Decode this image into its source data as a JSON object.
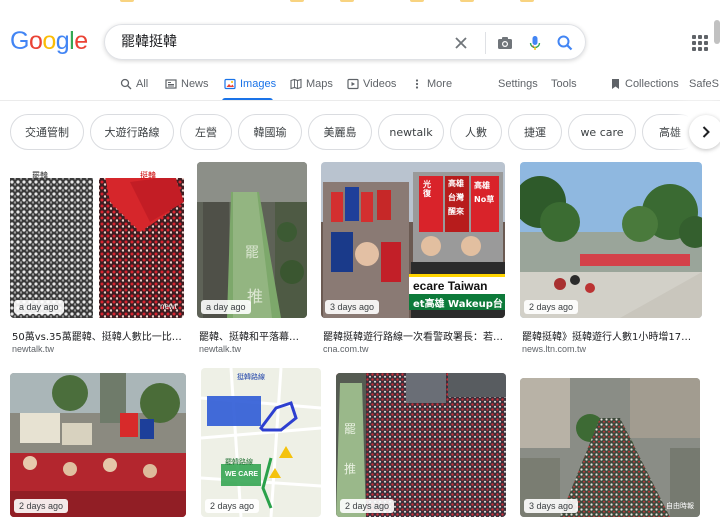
{
  "search": {
    "query": "罷韓挺韓"
  },
  "logo": {
    "letters": [
      "G",
      "o",
      "o",
      "g",
      "l",
      "e"
    ]
  },
  "tabs": [
    {
      "label": "All",
      "icon": "search-icon",
      "active": false
    },
    {
      "label": "News",
      "icon": "newspaper-icon",
      "active": false
    },
    {
      "label": "Images",
      "icon": "image-icon",
      "active": true
    },
    {
      "label": "Maps",
      "icon": "map-icon",
      "active": false
    },
    {
      "label": "Videos",
      "icon": "play-icon",
      "active": false
    },
    {
      "label": "More",
      "icon": "more-vert-icon",
      "active": false
    }
  ],
  "tools": {
    "settings": "Settings",
    "tools": "Tools",
    "collections": "Collections",
    "safesearch": "SafeS"
  },
  "chips": [
    "交通管制",
    "大遊行路線",
    "左營",
    "韓國瑜",
    "美麗島",
    "newtalk",
    "人數",
    "捷運",
    "we care",
    "高雄"
  ],
  "row1": [
    {
      "age": "a day ago",
      "title": "50萬vs.35萬罷韓、挺韓人數比一比| 政...",
      "source": "newtalk.tw",
      "labels": [
        "罷韓",
        "挺韓"
      ],
      "watermark": "newt"
    },
    {
      "age": "a day ago",
      "title": "罷韓、挺韓和平落幕王...",
      "source": "newtalk.tw"
    },
    {
      "age": "3 days ago",
      "title": "罷韓挺韓遊行路線一次看警政署長：若有...",
      "source": "cna.com.tw",
      "signs": [
        "光復",
        "高雄",
        "台灣",
        "醒來",
        "高雄",
        "No草"
      ],
      "banner1": "ecare Taiwan",
      "banner2": "et高雄 Wakeup台"
    },
    {
      "age": "2 days ago",
      "title": "罷韓挺韓》挺韓遊行人數1小時增17萬遭...",
      "source": "news.ltn.com.tw"
    }
  ],
  "row2": [
    {
      "age": "2 days ago"
    },
    {
      "age": "2 days ago",
      "map_title": "挺韓路線",
      "map_box": "WE CARE",
      "map_label": "罷韓路線"
    },
    {
      "age": "2 days ago"
    },
    {
      "age": "3 days ago",
      "watermark": "自由時報"
    }
  ],
  "colors": {
    "accent": "#1a73e8",
    "chip_border": "#dadce0",
    "text_muted": "#5f6368"
  }
}
